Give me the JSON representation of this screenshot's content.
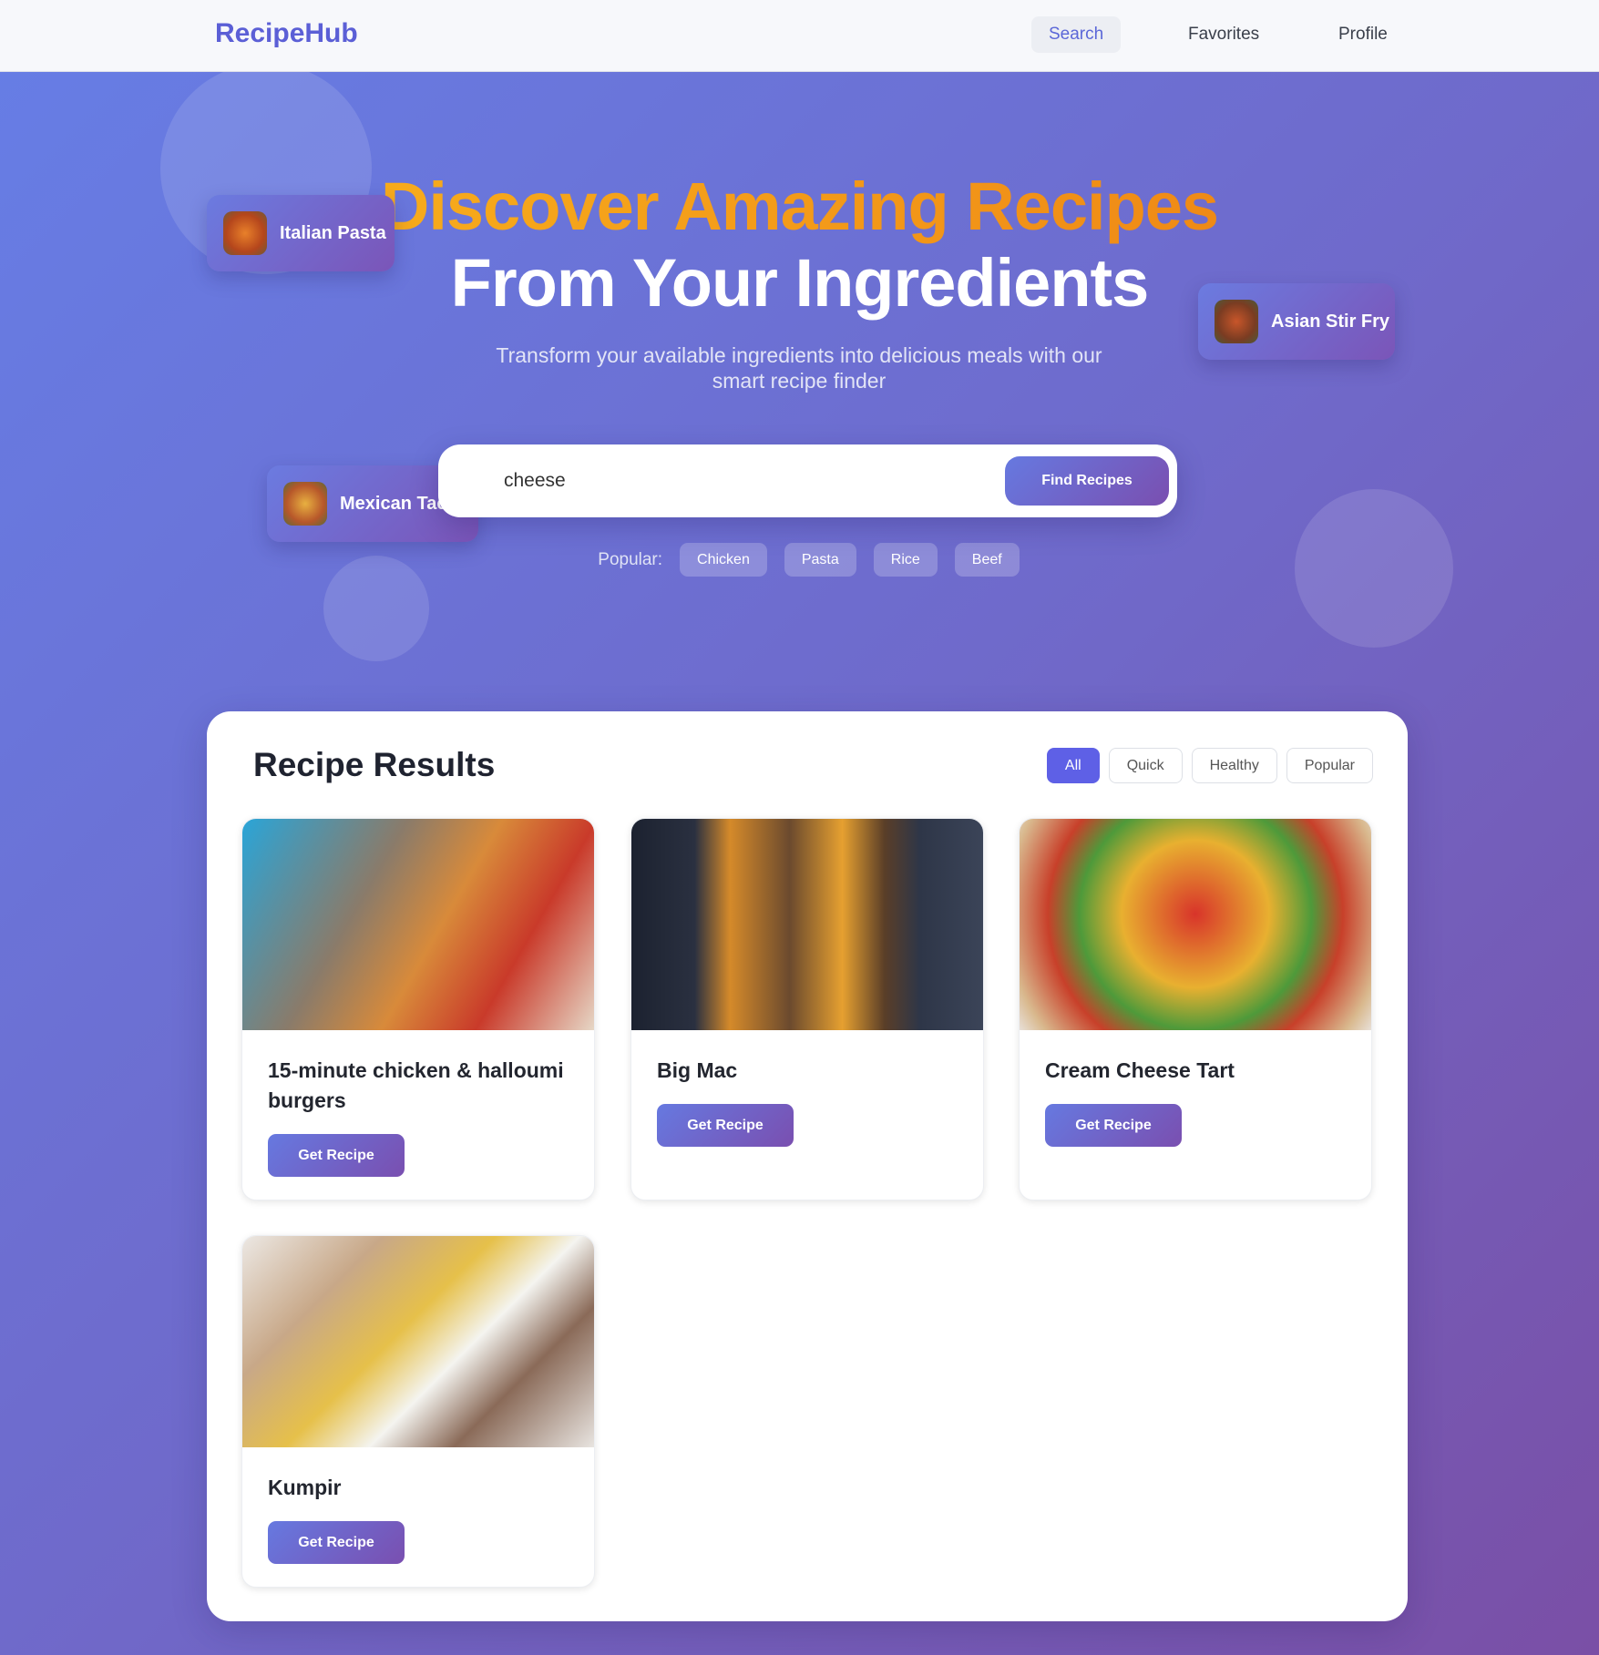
{
  "nav": {
    "logo": "RecipeHub",
    "links": [
      {
        "label": "Search",
        "active": true
      },
      {
        "label": "Favorites"
      },
      {
        "label": "Profile"
      }
    ]
  },
  "hero": {
    "title_line1": "Discover Amazing Recipes",
    "title_line2": "From Your Ingredients",
    "subtitle": "Transform your available ingredients into delicious meals with our smart recipe finder",
    "badges": [
      {
        "label": "Italian Pasta"
      },
      {
        "label": "Asian Stir Fry"
      },
      {
        "label": "Mexican Tacos"
      }
    ],
    "search": {
      "value": "cheese",
      "button": "Find Recipes"
    },
    "popular_label": "Popular:",
    "popular": [
      "Chicken",
      "Pasta",
      "Rice",
      "Beef"
    ]
  },
  "results": {
    "title": "Recipe Results",
    "filters": [
      {
        "label": "All",
        "active": true
      },
      {
        "label": "Quick"
      },
      {
        "label": "Healthy"
      },
      {
        "label": "Popular"
      }
    ],
    "recipes": [
      {
        "title": "15-minute chicken & halloumi burgers",
        "button": "Get Recipe"
      },
      {
        "title": "Big Mac",
        "button": "Get Recipe"
      },
      {
        "title": "Cream Cheese Tart",
        "button": "Get Recipe"
      },
      {
        "title": "Kumpir",
        "button": "Get Recipe"
      }
    ]
  },
  "colors": {
    "brand": "#5b5fd6",
    "accent": "#f6a21a",
    "button_gradient_start": "#6679e0",
    "button_gradient_end": "#7a4fb0"
  }
}
